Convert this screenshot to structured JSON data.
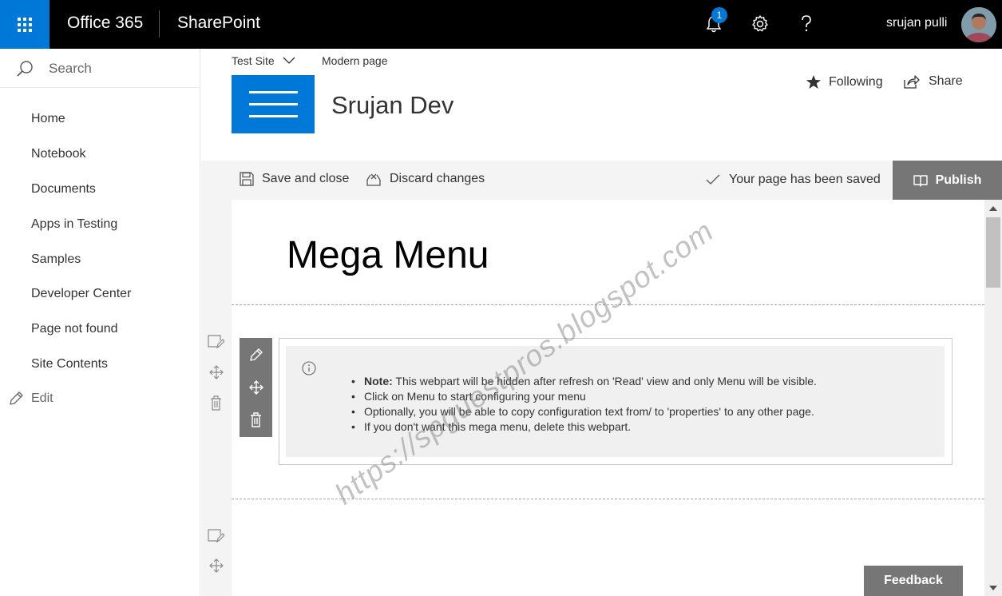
{
  "suite_bar": {
    "brand": "Office 365",
    "app": "SharePoint",
    "notification_count": "1",
    "user_name": "srujan pulli"
  },
  "left_nav": {
    "search_placeholder": "Search",
    "items": [
      "Home",
      "Notebook",
      "Documents",
      "Apps in Testing",
      "Samples",
      "Developer Center",
      "Page not found",
      "Site Contents"
    ],
    "edit_label": "Edit"
  },
  "site_header": {
    "breadcrumb_site": "Test Site",
    "breadcrumb_page": "Modern page",
    "site_title": "Srujan Dev",
    "following_label": "Following",
    "share_label": "Share"
  },
  "command_bar": {
    "save_close_label": "Save and close",
    "discard_label": "Discard changes",
    "status_text": "Your page has been saved",
    "publish_label": "Publish"
  },
  "page": {
    "title": "Mega Menu"
  },
  "webpart": {
    "note_prefix": "Note:",
    "note_text": " This webpart will be hidden after refresh on 'Read' view and only Menu will be visible.",
    "line2": "Click on Menu to start configuring your menu",
    "line3": "Optionally, you will be able to copy configuration text from/ to 'properties' to any other page.",
    "line4": "If you don't want this mega menu, delete this webpart."
  },
  "feedback_label": "Feedback",
  "watermark_text": "https://spguestpros.blogspot.com",
  "colors": {
    "suite_bar": "#000000",
    "waffle": "#0078d7",
    "accent": "#0078d7",
    "publish": "#767676",
    "command_bar": "#f4f4f4"
  },
  "icons": {
    "waffle": "app-launcher-icon",
    "notifications": "bell-icon",
    "settings": "gear-icon",
    "help": "question-icon",
    "search": "search-icon",
    "edit": "pencil-icon",
    "following": "star-icon",
    "share": "share-icon",
    "save": "floppy-disk-icon",
    "discard": "discard-icon",
    "saved": "checkmark-icon",
    "publish": "book-icon",
    "info": "info-icon",
    "move": "move-icon",
    "delete": "trash-icon"
  }
}
